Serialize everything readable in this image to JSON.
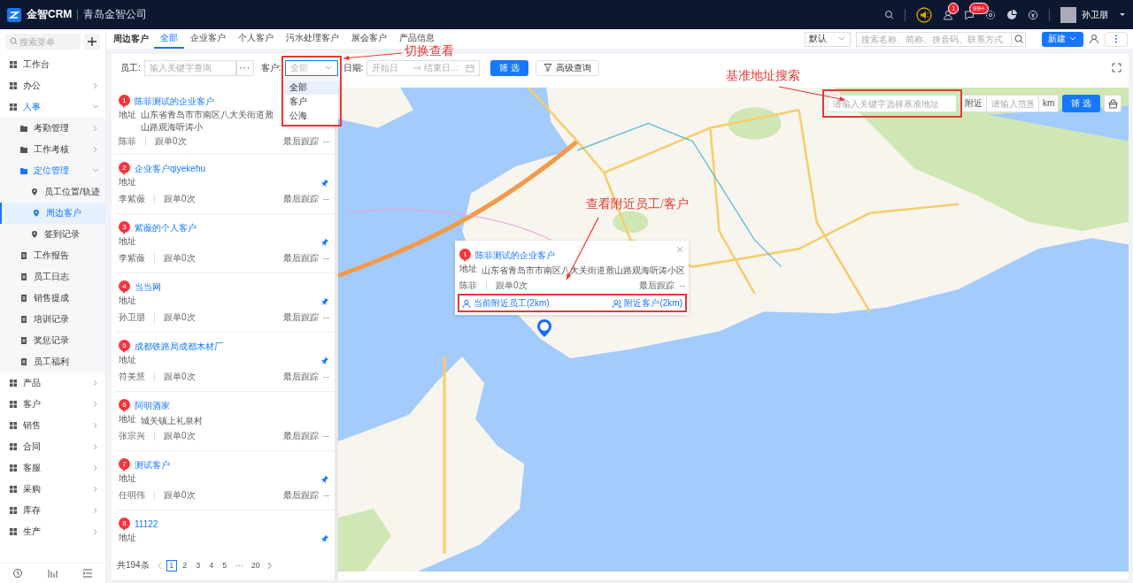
{
  "topbar": {
    "app_name": "金智CRM",
    "company": "青岛金智公司",
    "notifications": [
      {
        "badge": "1"
      },
      {
        "badge": "99+"
      }
    ],
    "user_name": "孙卫朋"
  },
  "sidebar": {
    "search_placeholder": "搜索菜单",
    "items": [
      {
        "label": "工作台",
        "selected": false
      },
      {
        "label": "办公",
        "selected": false,
        "expanded": false
      },
      {
        "label": "人事",
        "selected": false,
        "expanded": true,
        "children": [
          {
            "label": "考勤管理",
            "selected": false,
            "expanded": false
          },
          {
            "label": "工作考核",
            "selected": false,
            "expanded": false
          },
          {
            "label": "定位管理",
            "selected": false,
            "expanded": true,
            "children": [
              {
                "label": "员工位置/轨迹",
                "selected": false
              },
              {
                "label": "周边客户",
                "selected": true
              },
              {
                "label": "签到记录",
                "selected": false
              }
            ]
          },
          {
            "label": "工作报告",
            "selected": false
          },
          {
            "label": "员工日志",
            "selected": false
          },
          {
            "label": "销售提成",
            "selected": false
          },
          {
            "label": "培训记录",
            "selected": false
          },
          {
            "label": "奖惩记录",
            "selected": false
          },
          {
            "label": "员工福利",
            "selected": false
          }
        ]
      },
      {
        "label": "产品",
        "selected": false,
        "expanded": false
      },
      {
        "label": "客户",
        "selected": false,
        "expanded": false
      },
      {
        "label": "销售",
        "selected": false,
        "expanded": false
      },
      {
        "label": "合同",
        "selected": false,
        "expanded": false
      },
      {
        "label": "客服",
        "selected": false,
        "expanded": false
      },
      {
        "label": "采购",
        "selected": false,
        "expanded": false
      },
      {
        "label": "库存",
        "selected": false,
        "expanded": false
      },
      {
        "label": "生产",
        "selected": false,
        "expanded": false
      }
    ]
  },
  "page": {
    "title": "周边客户",
    "tabs": [
      {
        "label": "全部",
        "selected": true
      },
      {
        "label": "企业客户",
        "selected": false
      },
      {
        "label": "个人客户",
        "selected": false
      },
      {
        "label": "污水处理客户",
        "selected": false
      },
      {
        "label": "展会客户",
        "selected": false
      },
      {
        "label": "产品信息",
        "selected": false
      }
    ],
    "sort_select": "默认",
    "search_placeholder": "搜索名称、简称、拼音码、联系方式",
    "new_button": "新建"
  },
  "filters": {
    "employee": {
      "label": "员工:",
      "placeholder": "输入关键字查询",
      "more": "···"
    },
    "customer": {
      "label": "客户:",
      "value": "全部",
      "open": true,
      "highlighted": true,
      "options": [
        {
          "label": "全部",
          "selected": true
        },
        {
          "label": "客户",
          "selected": false
        },
        {
          "label": "公海",
          "selected": false
        }
      ]
    },
    "date": {
      "label": "日期:",
      "start_placeholder": "开始日",
      "end_placeholder": "结束日..."
    },
    "filter_button": "筛 选",
    "advanced_button": "高级查询"
  },
  "customers": [
    {
      "number": "1",
      "name": "陈菲测试的企业客户",
      "address_label": "地址",
      "address": "山东省青岛市市南区八大关街道鼐山路观海听涛小",
      "pinned": false,
      "owner": "陈菲",
      "follow": "跟单0次",
      "last_label": "最后跟踪",
      "last_value": "--"
    },
    {
      "number": "2",
      "name": "企业客户qiyekehu",
      "address_label": "地址",
      "pinned": true,
      "owner": "李紫薇",
      "follow": "跟单0次",
      "last_label": "最后跟踪",
      "last_value": "--"
    },
    {
      "number": "3",
      "name": "紫薇的个人客户",
      "address_label": "地址",
      "pinned": true,
      "owner": "李紫薇",
      "follow": "跟单0次",
      "last_label": "最后跟踪",
      "last_value": "--"
    },
    {
      "number": "4",
      "name": "当当网",
      "address_label": "地址",
      "pinned": true,
      "owner": "孙卫朋",
      "follow": "跟单0次",
      "last_label": "最后跟踪",
      "last_value": "--"
    },
    {
      "number": "5",
      "name": "成都铁路局成都木材厂",
      "address_label": "地址",
      "pinned": true,
      "owner": "符美慧",
      "follow": "跟单0次",
      "last_label": "最后跟踪",
      "last_value": "--"
    },
    {
      "number": "6",
      "name": "阿明酒家",
      "address_label": "地址",
      "address": "城关镇上礼泉村",
      "pinned": false,
      "owner": "张宗兴",
      "follow": "跟单0次",
      "last_label": "最后跟踪",
      "last_value": "--"
    },
    {
      "number": "7",
      "name": "测试客户",
      "address_label": "地址",
      "pinned": true,
      "owner": "任明伟",
      "follow": "跟单0次",
      "last_label": "最后跟踪",
      "last_value": "--"
    },
    {
      "number": "8",
      "name": "11122",
      "address_label": "地址",
      "pinned": true
    }
  ],
  "pagination": {
    "total": "共194条",
    "pages": [
      {
        "label": "1",
        "selected": true
      },
      {
        "label": "2",
        "selected": false
      },
      {
        "label": "3",
        "selected": false
      },
      {
        "label": "4",
        "selected": false
      },
      {
        "label": "5",
        "selected": false
      },
      {
        "label": "···",
        "selected": false
      },
      {
        "label": "20",
        "selected": false
      }
    ]
  },
  "map": {
    "search": {
      "placeholder": "请输入关键字选择基准地址",
      "highlighted": true
    },
    "nearby_label": "附近",
    "range_placeholder": "请输入范围",
    "unit": "km",
    "filter_button": "筛 选",
    "popup": {
      "number": "1",
      "name": "陈菲测试的企业客户",
      "address_label": "地址",
      "address": "山东省青岛市市南区八大关街道鼐山路观海听涛小区",
      "owner": "陈菲",
      "follow": "跟单0次",
      "last_label": "最后跟踪",
      "last_value": "--",
      "actions_highlighted": true,
      "actions": [
        {
          "label": "当前附近员工(2km)"
        },
        {
          "label": "附近客户(2km)"
        }
      ]
    }
  },
  "annotations": [
    {
      "text": "切换查看"
    },
    {
      "text": "基准地址搜索"
    },
    {
      "text": "查看附近员工/客户"
    }
  ]
}
